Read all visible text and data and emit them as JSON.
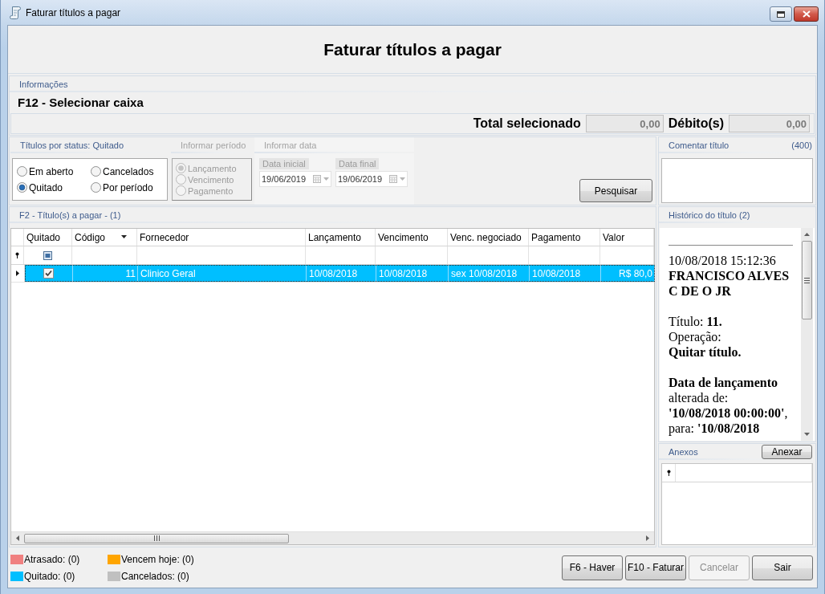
{
  "window": {
    "title": "Faturar títulos a pagar"
  },
  "header": {
    "title": "Faturar títulos a pagar"
  },
  "info": {
    "title": "Informações",
    "shortcut_hint": "F12 - Selecionar caixa",
    "total_label": "Total selecionado",
    "total_value": "0,00",
    "debit_label": "Débito(s)",
    "debit_value": "0,00"
  },
  "status_filter": {
    "title": "Títulos por status: Quitado",
    "options": [
      {
        "label": "Em aberto",
        "selected": false
      },
      {
        "label": "Cancelados",
        "selected": false
      },
      {
        "label": "Quitado",
        "selected": true
      },
      {
        "label": "Por período",
        "selected": false
      }
    ]
  },
  "period_filter": {
    "title": "Informar período",
    "disabled": true,
    "options": [
      {
        "label": "Lançamento",
        "selected": true
      },
      {
        "label": "Vencimento",
        "selected": false
      },
      {
        "label": "Pagamento",
        "selected": false
      }
    ]
  },
  "date_filter": {
    "title": "Informar data",
    "disabled": true,
    "fields": [
      {
        "label": "Data inicial",
        "value": "19/06/2019"
      },
      {
        "label": "Data final",
        "value": "19/06/2019"
      }
    ]
  },
  "search_button": "Pesquisar",
  "comment": {
    "title": "Comentar título",
    "counter": "(400)"
  },
  "table": {
    "title": "F2 - Título(s) a pagar - (1)",
    "columns": [
      {
        "label": "Quitado",
        "kind": "check",
        "sorted": false
      },
      {
        "label": "Código",
        "kind": "number",
        "sorted": true
      },
      {
        "label": "Fornecedor",
        "kind": "text",
        "sorted": false
      },
      {
        "label": "Lançamento",
        "kind": "text",
        "sorted": false
      },
      {
        "label": "Vencimento",
        "kind": "text",
        "sorted": false
      },
      {
        "label": "Venc. negociado",
        "kind": "text",
        "sorted": false
      },
      {
        "label": "Pagamento",
        "kind": "text",
        "sorted": false
      },
      {
        "label": "Valor",
        "kind": "number",
        "sorted": false
      }
    ],
    "rows": [
      {
        "selected": true,
        "color": "#00bfff",
        "cells": [
          true,
          "11",
          "Clinico Geral",
          "10/08/2018",
          "10/08/2018",
          "sex 10/08/2018",
          "10/08/2018",
          "R$ 80,0"
        ]
      }
    ]
  },
  "history": {
    "title": "Histórico do título (2)",
    "entries": [
      {
        "timestamp": "10/08/2018 15:12:36",
        "author": "FRANCISCO ALVES C DE O JR",
        "blocks": [
          [
            {
              "kind": "field",
              "text": "Título: **11.**"
            },
            {
              "kind": "label",
              "text": "Operação:"
            },
            {
              "kind": "value",
              "text": "Quitar título."
            }
          ],
          [
            {
              "kind": "field",
              "text": "**Data de lançamento** alterada de: **'10/08/2018 00:00:00'**, para: **'10/08/2018**"
            }
          ]
        ]
      }
    ]
  },
  "attachments": {
    "title": "Anexos",
    "button": "Anexar"
  },
  "legend": [
    {
      "label": "Atrasado: (0)",
      "color": "#f08080"
    },
    {
      "label": "Vencem hoje: (0)",
      "color": "#ffa500"
    },
    {
      "label": "Quitado: (0)",
      "color": "#00bfff"
    },
    {
      "label": "Cancelados: (0)",
      "color": "#c0c0c0"
    }
  ],
  "buttons": [
    {
      "label": "F6 - Haver",
      "disabled": false
    },
    {
      "label": "F10 - Faturar",
      "disabled": false
    },
    {
      "label": "Cancelar",
      "disabled": true
    },
    {
      "label": "Sair",
      "disabled": false
    }
  ]
}
